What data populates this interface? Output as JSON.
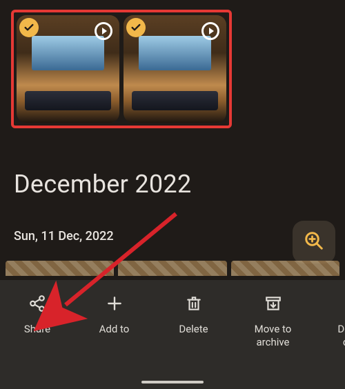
{
  "month_header": "December 2022",
  "date_label": "Sun, 11 Dec, 2022",
  "selected_photos": [
    {
      "selected": true,
      "motion": true
    },
    {
      "selected": true,
      "motion": true
    }
  ],
  "zoom": {
    "label": "zoom-in"
  },
  "actions": [
    {
      "label": "Share"
    },
    {
      "label": "Add to"
    },
    {
      "label": "Delete"
    },
    {
      "label": "Move to\narchive"
    },
    {
      "label": "Delete\ndevi"
    }
  ]
}
